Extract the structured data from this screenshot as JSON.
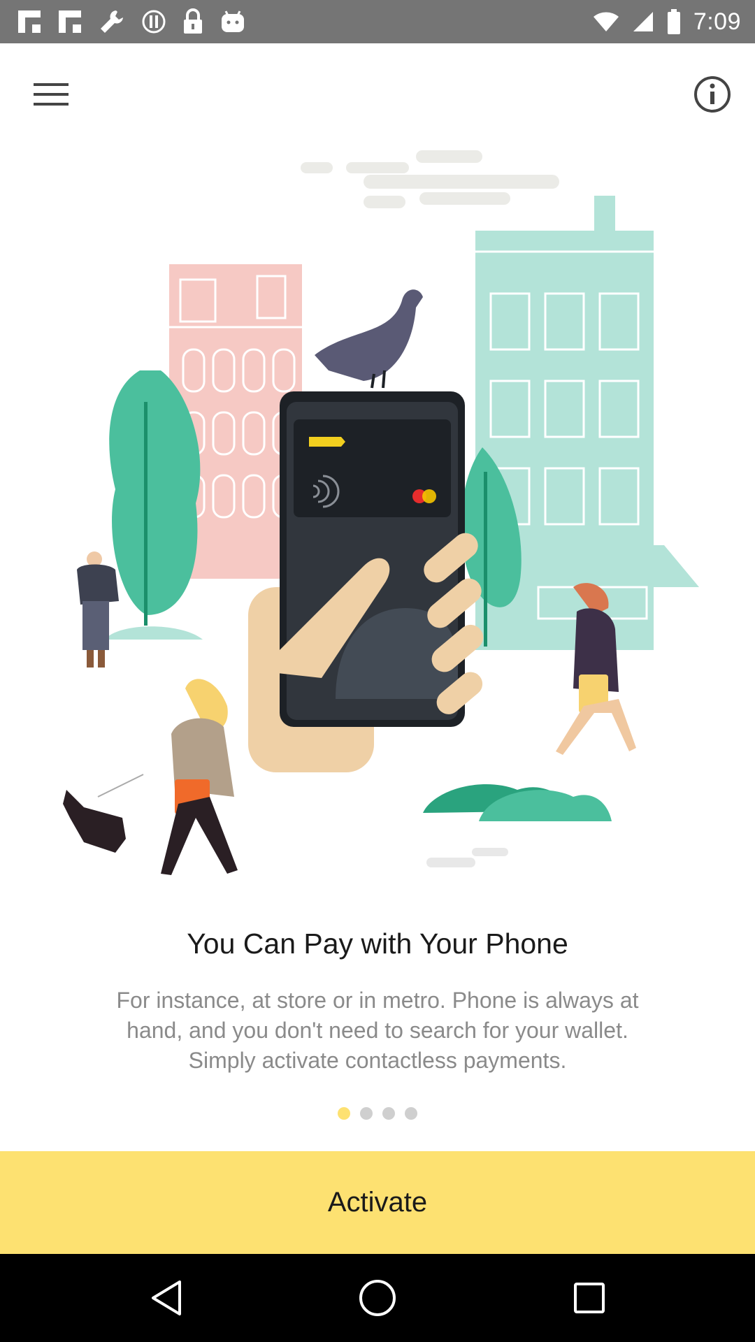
{
  "status_bar": {
    "time": "7:09",
    "left_icons": [
      "flipboard-icon",
      "flipboard-icon",
      "wrench-icon",
      "vpn-icon",
      "lock-icon",
      "android-icon"
    ],
    "right_icons": [
      "wifi-icon",
      "signal-icon",
      "battery-icon"
    ]
  },
  "header": {
    "menu_icon": "hamburger-menu-icon",
    "info_icon": "info-circle-icon"
  },
  "onboarding": {
    "title": "You Can Pay with Your Phone",
    "description_lines": [
      "For instance, at store or in metro. Phone is always at",
      "hand, and you don't need to search for your wallet.",
      "Simply activate contactless payments."
    ],
    "pages_total": 4,
    "current_page": 1,
    "activate_label": "Activate"
  },
  "colors": {
    "accent": "#fde171",
    "status_bar": "#757575",
    "nav_bar": "#000000"
  },
  "nav_bar": {
    "icons": [
      "back-icon",
      "home-icon",
      "recents-icon"
    ]
  }
}
